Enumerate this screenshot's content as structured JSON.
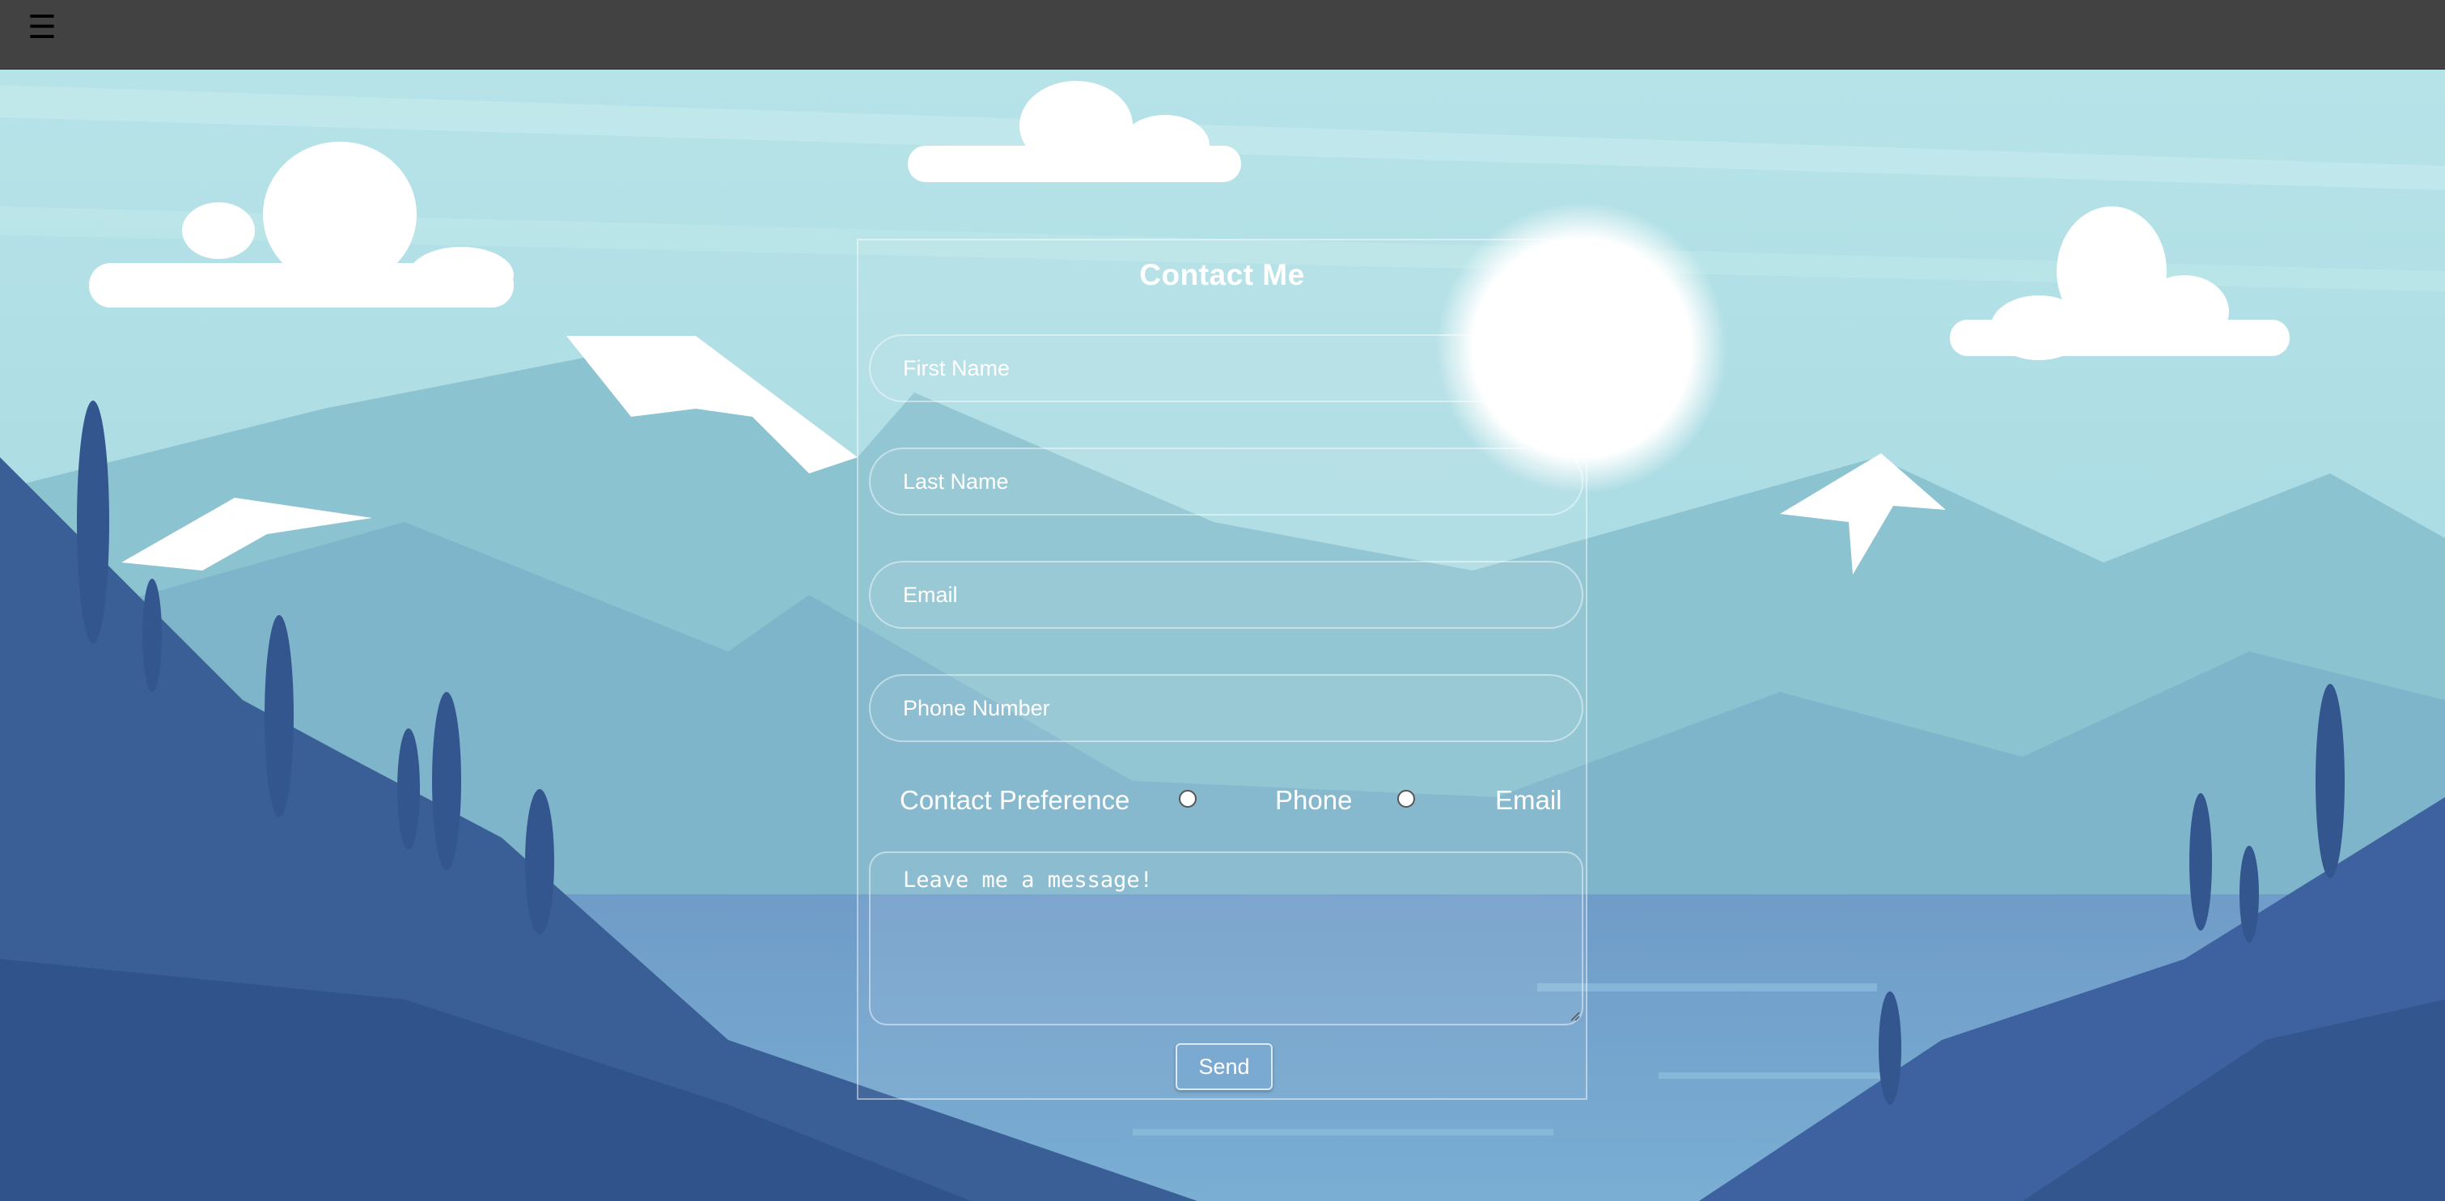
{
  "topbar": {
    "menu_icon": "hamburger-menu-icon",
    "menu_glyph": "☰"
  },
  "form": {
    "title": "Contact Me",
    "first_name_placeholder": "First Name",
    "last_name_placeholder": "Last Name",
    "email_placeholder": "Email",
    "phone_placeholder": "Phone Number",
    "preference_label": "Contact Preference",
    "preference_options": [
      "Phone",
      "Email"
    ],
    "message_placeholder": "Leave me a message!",
    "send_label": "Send"
  },
  "colors": {
    "topbar": "#424242",
    "sky": "#a9dde4",
    "mountain_dark": "#34568f",
    "text": "#ffffff"
  }
}
